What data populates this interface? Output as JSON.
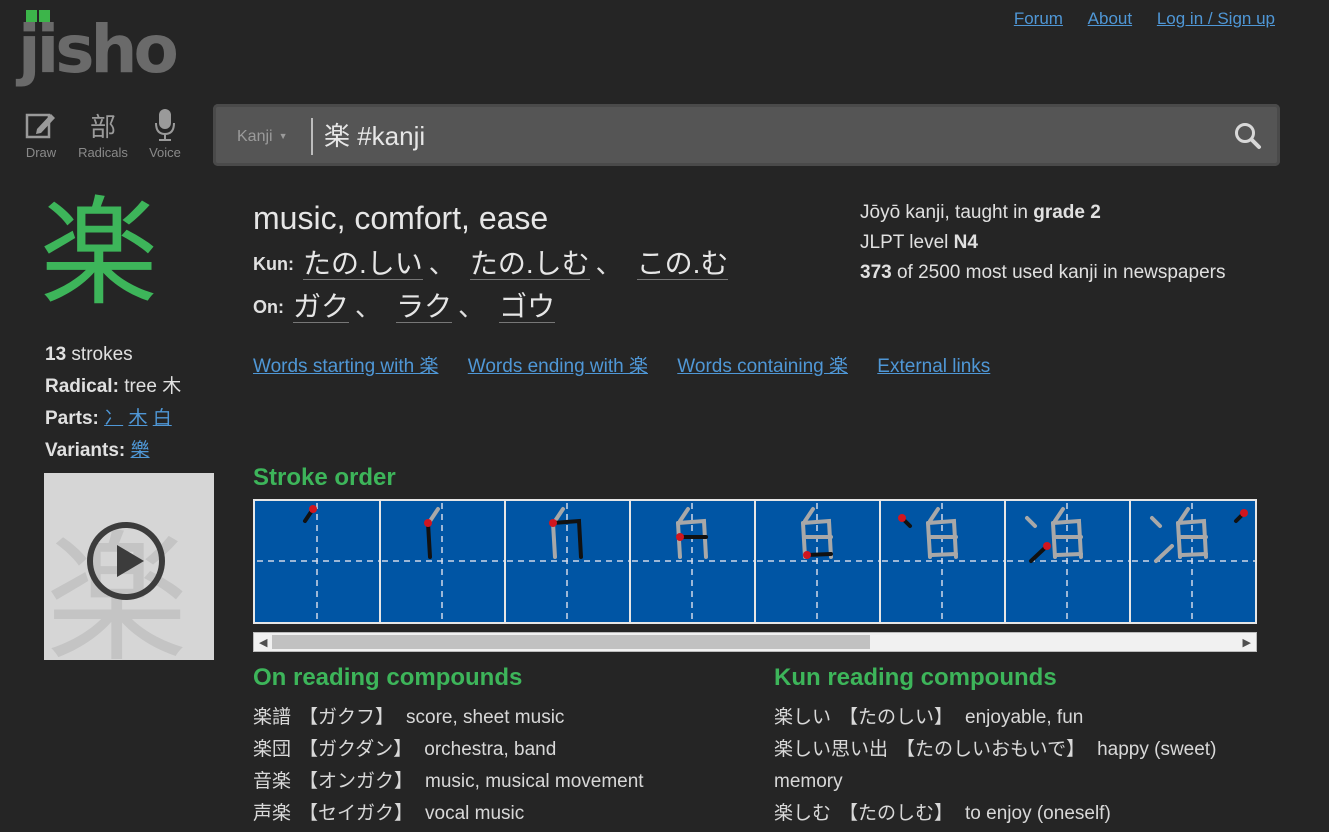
{
  "logo": {
    "text": "jisho"
  },
  "nav": {
    "items": [
      "Forum",
      "About",
      "Log in / Sign up"
    ]
  },
  "tools": [
    {
      "label": "Draw",
      "icon": "pencil-icon"
    },
    {
      "label": "Radicals",
      "icon": "部"
    },
    {
      "label": "Voice",
      "icon": "microphone-icon"
    }
  ],
  "search": {
    "dropdown": "Kanji",
    "query": "楽 #kanji"
  },
  "kanji": {
    "character": "楽",
    "strokes_count": "13",
    "strokes_word": "strokes",
    "radical_label": "Radical:",
    "radical_value": "tree 木",
    "parts_label": "Parts:",
    "parts": [
      "冫",
      "木",
      "白"
    ],
    "variants_label": "Variants:",
    "variants": [
      "樂"
    ]
  },
  "meanings": "music, comfort, ease",
  "kun": {
    "label": "Kun:",
    "readings": [
      "たの.しい",
      "たの.しむ",
      "この.む"
    ]
  },
  "on": {
    "label": "On:",
    "readings": [
      "ガク",
      "ラク",
      "ゴウ"
    ]
  },
  "meta": {
    "jouyou_prefix": "Jōyō kanji, taught in",
    "grade": "grade 2",
    "jlpt_prefix": "JLPT level",
    "jlpt": "N4",
    "freq_rank": "373",
    "freq_suffix": "of 2500 most used kanji in newspapers"
  },
  "links": [
    "Words starting with 楽",
    "Words ending with 楽",
    "Words containing 楽",
    "External links"
  ],
  "stroke_order": {
    "title": "Stroke order",
    "frames": 8,
    "scroll_position": 0
  },
  "on_compounds": {
    "title": "On reading compounds",
    "items": [
      {
        "word": "楽譜",
        "reading": "【ガクフ】",
        "meaning": "score, sheet music"
      },
      {
        "word": "楽団",
        "reading": "【ガクダン】",
        "meaning": "orchestra, band"
      },
      {
        "word": "音楽",
        "reading": "【オンガク】",
        "meaning": "music, musical movement"
      },
      {
        "word": "声楽",
        "reading": "【セイガク】",
        "meaning": "vocal music"
      }
    ]
  },
  "kun_compounds": {
    "title": "Kun reading compounds",
    "items": [
      {
        "word": "楽しい",
        "reading": "【たのしい】",
        "meaning": "enjoyable, fun"
      },
      {
        "word": "楽しい思い出",
        "reading": "【たのしいおもいで】",
        "meaning": "happy (sweet) memory"
      },
      {
        "word": "楽しむ",
        "reading": "【たのしむ】",
        "meaning": "to enjoy (oneself)"
      }
    ]
  },
  "colors": {
    "accent": "#3db55a",
    "link": "#4f97d6",
    "background": "#252525",
    "stroke_bg": "#0055a4"
  }
}
